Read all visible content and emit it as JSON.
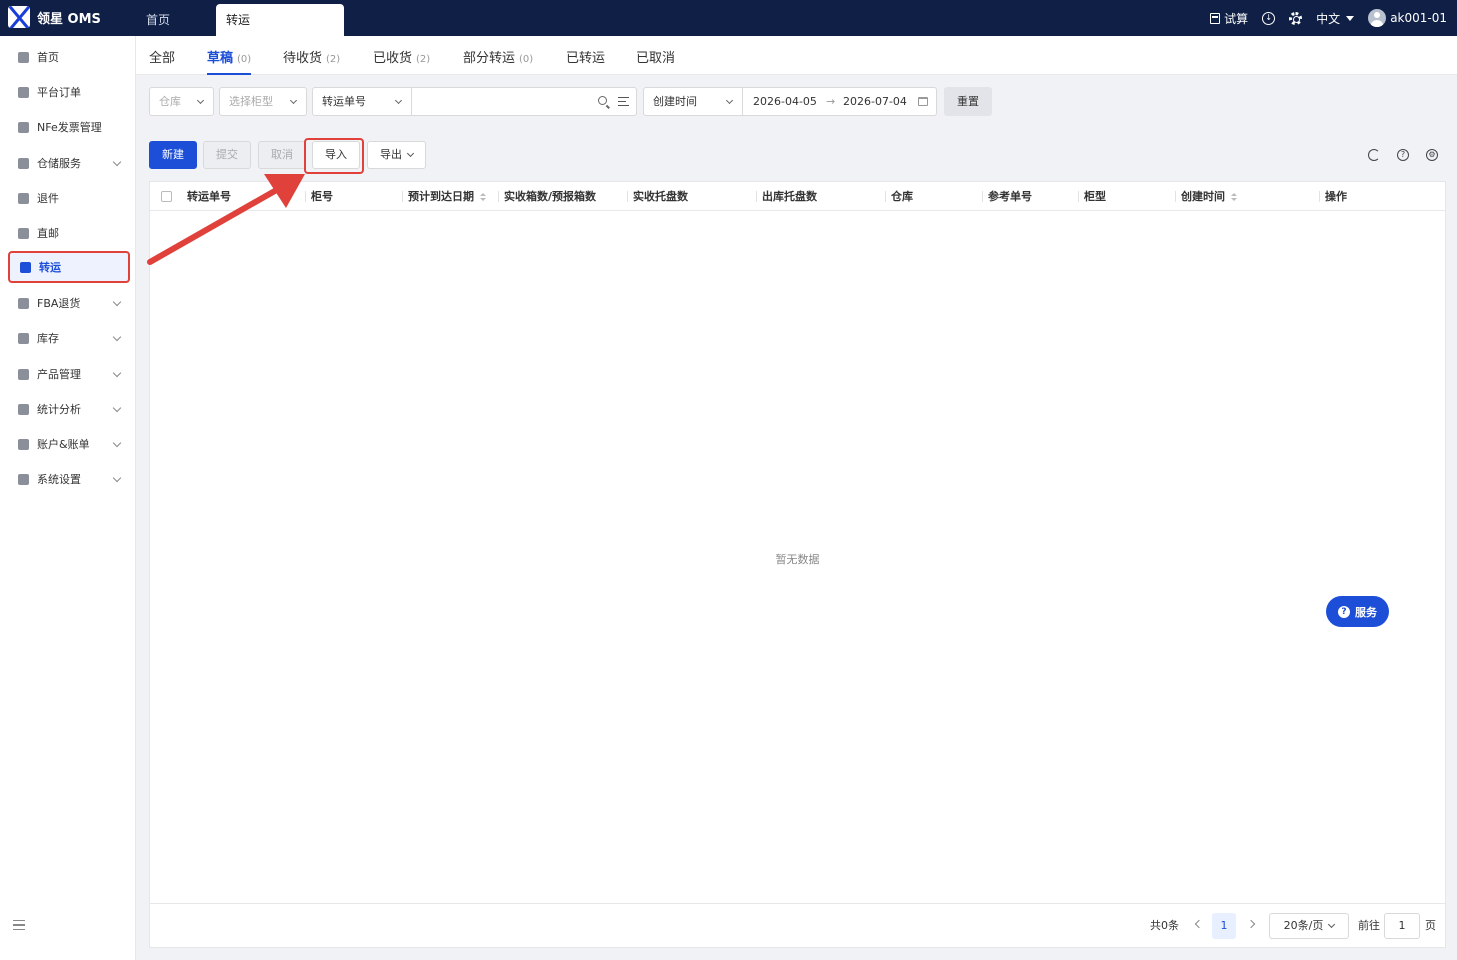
{
  "app": {
    "logo_text": "领星 OMS",
    "tabs": [
      {
        "label": "首页"
      },
      {
        "label": "转运"
      }
    ],
    "top_right": {
      "calc_label": "试算",
      "language": "中文",
      "user": "ak001-01"
    }
  },
  "sidebar": {
    "items": [
      {
        "label": "首页"
      },
      {
        "label": "平台订单"
      },
      {
        "label": "NFe发票管理"
      },
      {
        "label": "仓储服务"
      },
      {
        "label": "退件"
      },
      {
        "label": "直邮"
      },
      {
        "label": "转运"
      },
      {
        "label": "FBA退货"
      },
      {
        "label": "库存"
      },
      {
        "label": "产品管理"
      },
      {
        "label": "统计分析"
      },
      {
        "label": "账户&账单"
      },
      {
        "label": "系统设置"
      }
    ]
  },
  "status_tabs": [
    {
      "label": "全部",
      "count": ""
    },
    {
      "label": "草稿",
      "count": "(0)"
    },
    {
      "label": "待收货",
      "count": "(2)"
    },
    {
      "label": "已收货",
      "count": "(2)"
    },
    {
      "label": "部分转运",
      "count": "(0)"
    },
    {
      "label": "已转运",
      "count": ""
    },
    {
      "label": "已取消",
      "count": ""
    }
  ],
  "filters": {
    "warehouse_placeholder": "仓库",
    "container_type_placeholder": "选择柜型",
    "search_field": "转运单号",
    "search_value": "",
    "date_field": "创建时间",
    "date_start": "2026-04-05",
    "date_end": "2026-07-04",
    "reset_label": "重置"
  },
  "toolbar": {
    "new_label": "新建",
    "submit_label": "提交",
    "cancel_label": "取消",
    "import_label": "导入",
    "export_label": "导出"
  },
  "table": {
    "columns": [
      {
        "label": "转运单号"
      },
      {
        "label": "柜号"
      },
      {
        "label": "预计到达日期"
      },
      {
        "label": "实收箱数/预报箱数"
      },
      {
        "label": "实收托盘数"
      },
      {
        "label": "出库托盘数"
      },
      {
        "label": "仓库"
      },
      {
        "label": "参考单号"
      },
      {
        "label": "柜型"
      },
      {
        "label": "创建时间"
      },
      {
        "label": "操作"
      }
    ],
    "empty_text": "暂无数据"
  },
  "pagination": {
    "total": "共0条",
    "current_page": "1",
    "page_size": "20条/页",
    "goto_label": "前往",
    "goto_value": "1",
    "page_unit": "页"
  },
  "service_label": "服务",
  "colors": {
    "topbar": "#0f1f46",
    "primary": "#1d4ed8",
    "highlight": "#e0413a"
  }
}
